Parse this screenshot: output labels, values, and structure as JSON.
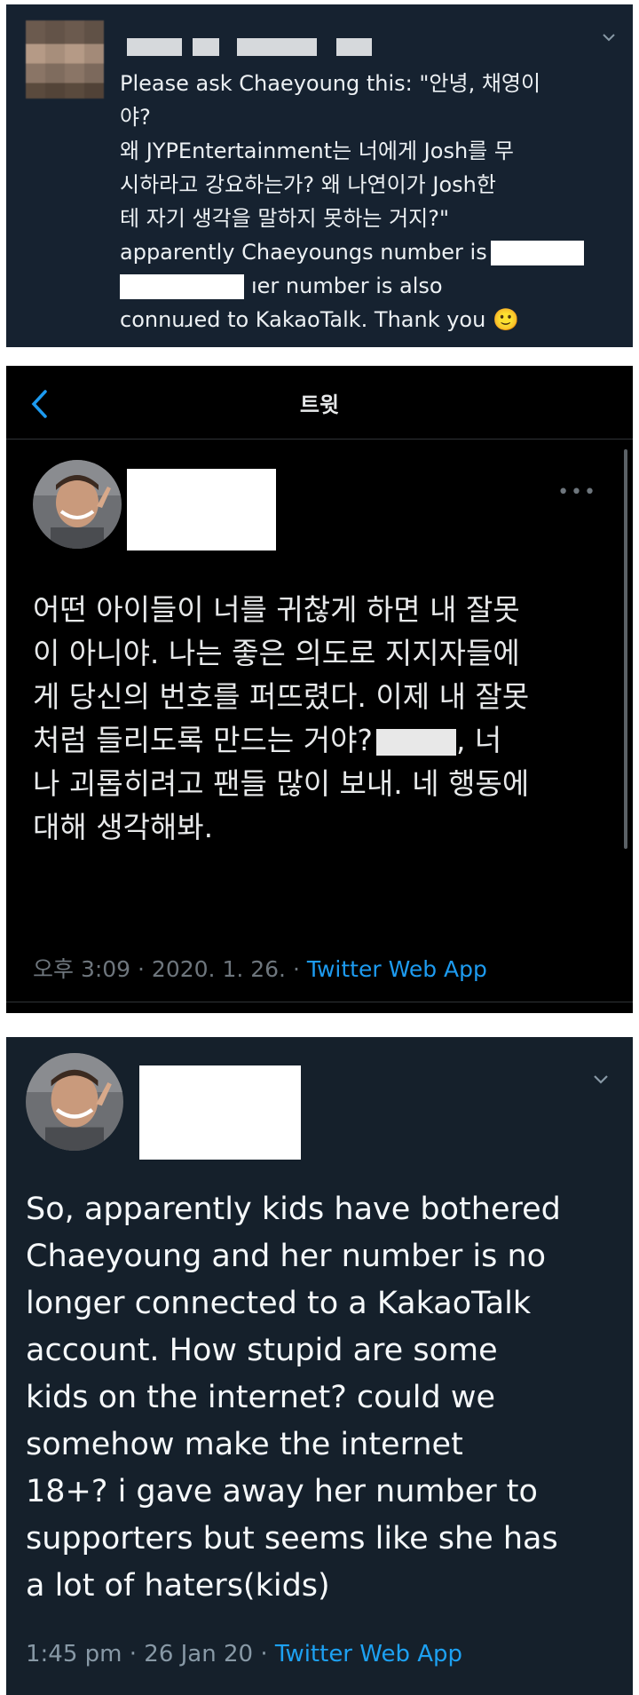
{
  "colors": {
    "panel1_bg": "#162230",
    "panel2_bg": "#000000",
    "panel3_bg": "#15202b",
    "link_blue": "#1d9bf0",
    "redaction": "#ffffff"
  },
  "reply_panel": {
    "menu_icon": "chevron-down-icon",
    "lines": [
      "Please ask Chaeyoung this: \"안녕, 채영이",
      "야?",
      "왜 JYPEntertainment는 너에게 Josh를 무",
      "시하라고 강요하는가? 왜 나연이가 Josh한",
      "테 자기 생각을 말하지 못하는 거지?\"",
      "apparently Chaeyoungs number is"
    ],
    "line7_end": "ıer number is also",
    "line8_start": "connu",
    "line8_end": "ɹed to KakaoTalk. Thank you",
    "emoji": "🙂"
  },
  "tweet_korean": {
    "header_title": "트윗",
    "back_icon": "chevron-left-icon",
    "more_icon": "more-dots-icon",
    "body_lines": [
      "어떤 아이들이 너를 귀찮게 하면 내 잘못",
      "이 아니야. 나는 좋은 의도로 지지자들에",
      "게 당신의 번호를 퍼뜨렸다. 이제 내 잘못",
      "처럼 들리도록 만드는 거야?",
      "나 괴롭히려고 팬들 많이 보내. 네 행동에",
      "대해 생각해봐."
    ],
    "line4_tail": ", 너",
    "meta_time": "오후 3:09 · 2020. 1. 26. · ",
    "meta_app": "Twitter Web App"
  },
  "tweet_english": {
    "menu_icon": "chevron-down-icon",
    "body_lines": [
      "So, apparently kids have bothered",
      "Chaeyoung and her number is no",
      "longer connected to a KakaoTalk",
      "account. How stupid are some",
      "kids on the internet? could we",
      "somehow make the internet",
      "18+? i gave away her number to",
      "supporters but seems like she has",
      "a lot of haters(kids)"
    ],
    "meta_time": "1:45 pm · 26 Jan 20 · ",
    "meta_app": "Twitter Web App"
  }
}
